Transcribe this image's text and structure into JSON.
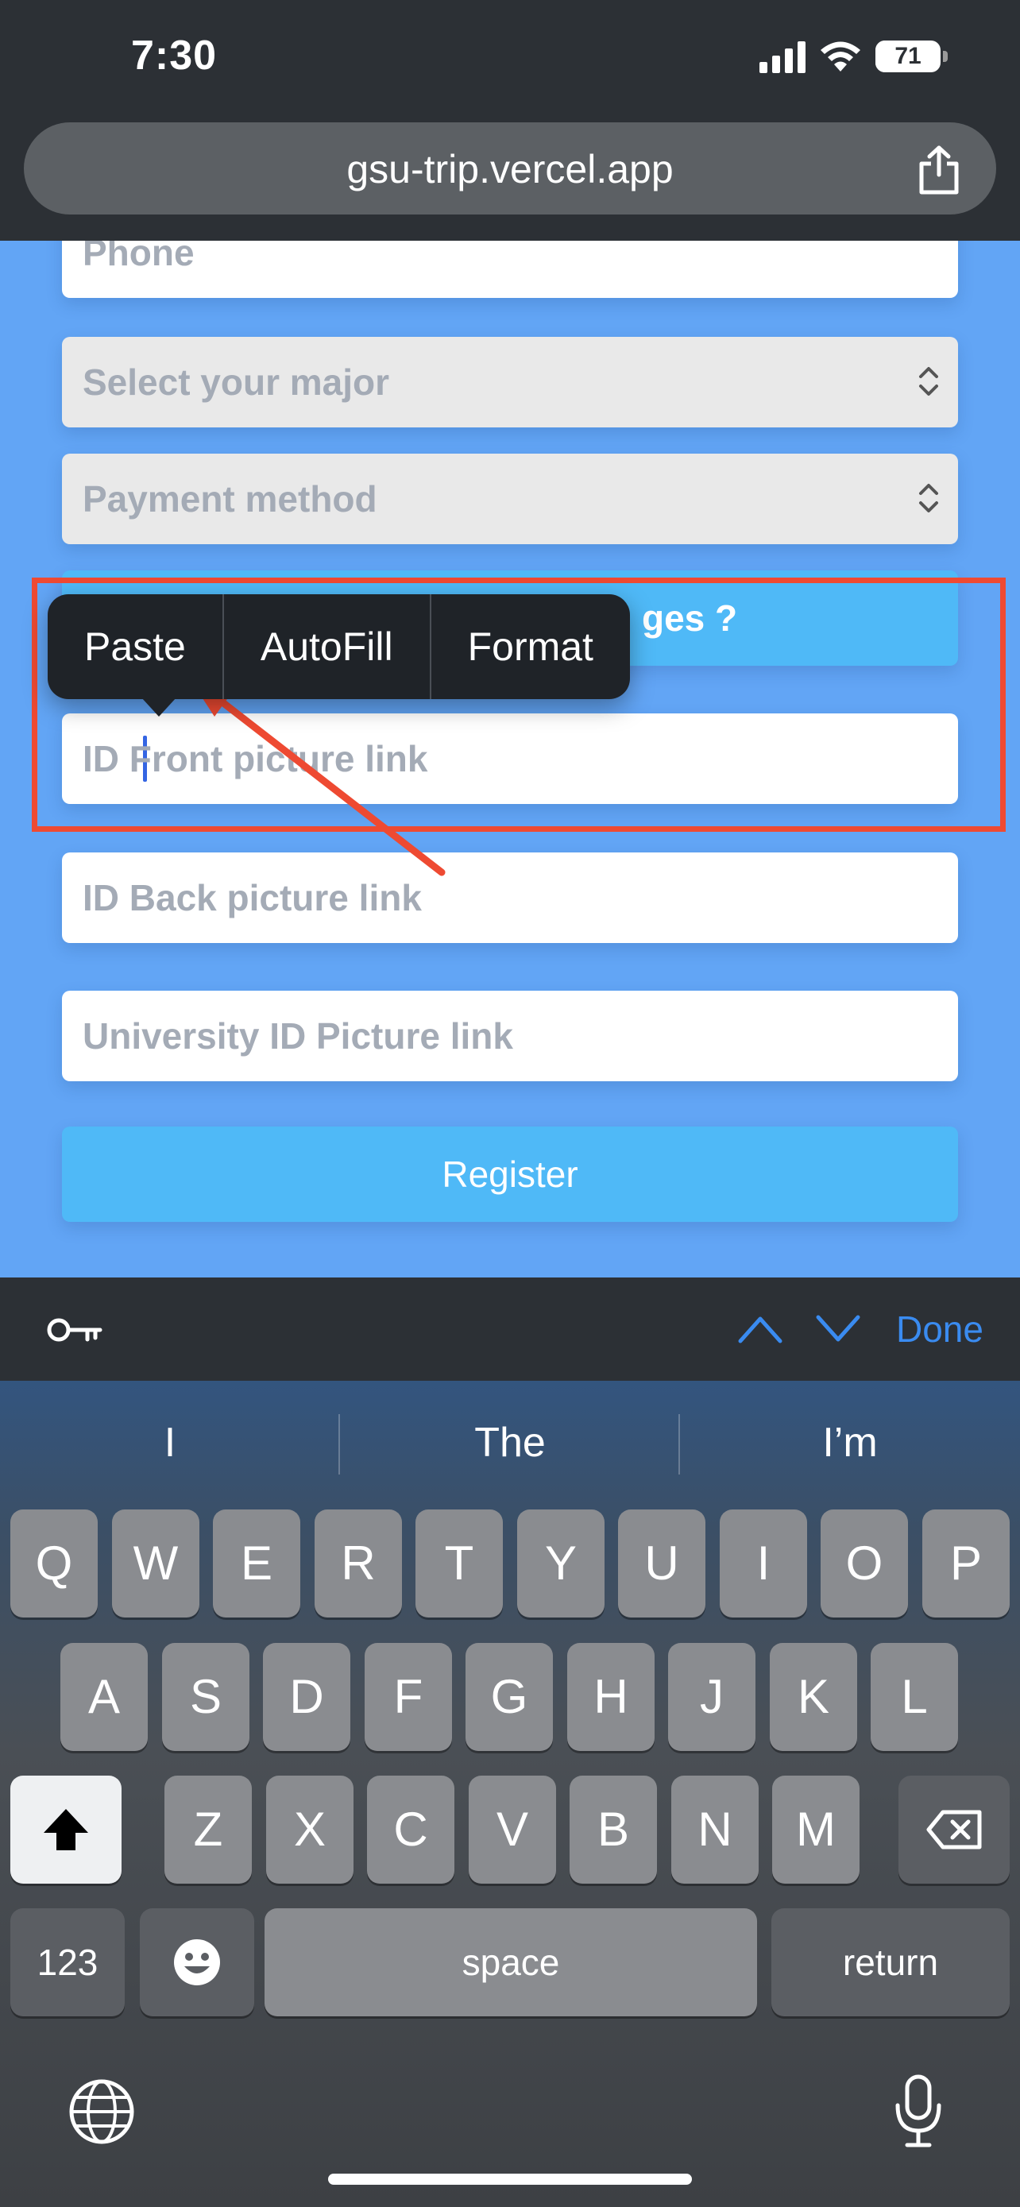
{
  "status_bar": {
    "time": "7:30",
    "battery": "71"
  },
  "browser": {
    "url": "gsu-trip.vercel.app"
  },
  "form": {
    "phone_placeholder": "Phone",
    "major_placeholder": "Select your major",
    "payment_placeholder": "Payment method",
    "hidden_button_partial": "ges ?",
    "id_front_placeholder": "ID Front picture link",
    "id_back_placeholder": "ID Back picture link",
    "university_id_placeholder": "University ID Picture link",
    "register_label": "Register"
  },
  "context_menu": {
    "items": [
      "Paste",
      "AutoFill",
      "Format"
    ]
  },
  "accessory_bar": {
    "done_label": "Done"
  },
  "keyboard": {
    "suggestions": [
      "I",
      "The",
      "I’m"
    ],
    "row1": [
      "Q",
      "W",
      "E",
      "R",
      "T",
      "Y",
      "U",
      "I",
      "O",
      "P"
    ],
    "row2": [
      "A",
      "S",
      "D",
      "F",
      "G",
      "H",
      "J",
      "K",
      "L"
    ],
    "row3": [
      "Z",
      "X",
      "C",
      "V",
      "B",
      "N",
      "M"
    ],
    "numbers_label": "123",
    "space_label": "space",
    "return_label": "return"
  },
  "annotation_color": "#ee4a32"
}
